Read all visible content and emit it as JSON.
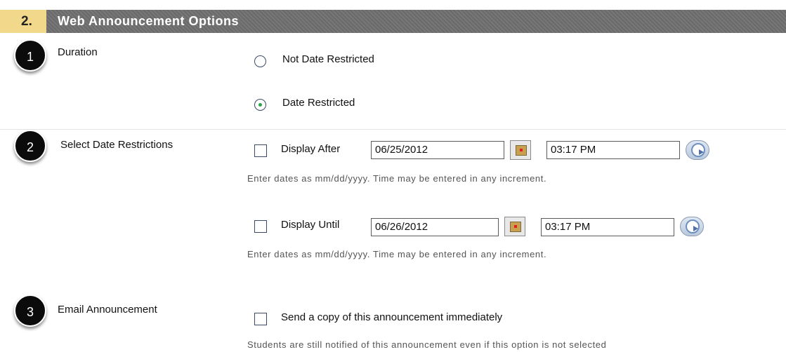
{
  "header": {
    "step_number": "2.",
    "title": "Web Announcement Options"
  },
  "badges": [
    "1",
    "2",
    "3"
  ],
  "duration": {
    "label": "Duration",
    "option_not_restricted": "Not Date Restricted",
    "option_restricted": "Date Restricted",
    "selected": "Date Restricted"
  },
  "date_restrictions": {
    "label": "Select Date Restrictions",
    "after": {
      "label": "Display After",
      "date": "06/25/2012",
      "time": "03:17 PM",
      "checked": false
    },
    "until": {
      "label": "Display Until",
      "date": "06/26/2012",
      "time": "03:17 PM",
      "checked": false
    },
    "hint": "Enter dates as mm/dd/yyyy. Time may be entered in any increment."
  },
  "email": {
    "label": "Email Announcement",
    "option": "Send a copy of this announcement immediately",
    "checked": false,
    "note": "Students are still notified of this announcement even if this option is not selected"
  },
  "colors": {
    "step_bg": "#f2d88a",
    "header_bg": "#707070",
    "radio_selected": "#2aa54a"
  },
  "icons": {
    "date_picker": "calendar-icon",
    "time_picker": "clock-icon"
  }
}
